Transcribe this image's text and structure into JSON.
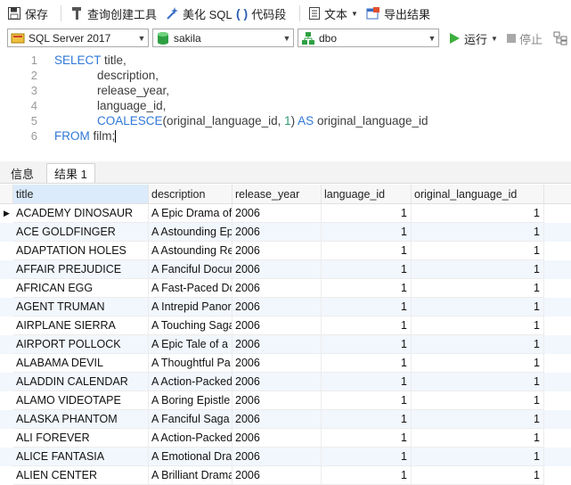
{
  "toolbar": {
    "save": "保存",
    "query_builder": "查询创建工具",
    "beautify": "美化 SQL",
    "snippet": "代码段",
    "text": "文本",
    "export": "导出结果"
  },
  "selectors": {
    "server": "SQL Server 2017",
    "database": "sakila",
    "schema": "dbo",
    "run": "运行",
    "stop": "停止"
  },
  "editor": {
    "line_numbers": [
      "1",
      "2",
      "3",
      "4",
      "5",
      "6"
    ]
  },
  "tabs": {
    "info": "信息",
    "result": "结果 1"
  },
  "table": {
    "columns": [
      "title",
      "description",
      "release_year",
      "language_id",
      "original_language_id"
    ],
    "rows": [
      [
        "ACADEMY DINOSAUR",
        "A Epic Drama of",
        "2006",
        "1",
        "1"
      ],
      [
        "ACE GOLDFINGER",
        "A Astounding Ep",
        "2006",
        "1",
        "1"
      ],
      [
        "ADAPTATION HOLES",
        "A Astounding Re",
        "2006",
        "1",
        "1"
      ],
      [
        "AFFAIR PREJUDICE",
        "A Fanciful Docur",
        "2006",
        "1",
        "1"
      ],
      [
        "AFRICAN EGG",
        "A Fast-Paced Dc",
        "2006",
        "1",
        "1"
      ],
      [
        "AGENT TRUMAN",
        "A Intrepid Panor",
        "2006",
        "1",
        "1"
      ],
      [
        "AIRPLANE SIERRA",
        "A Touching Saga",
        "2006",
        "1",
        "1"
      ],
      [
        "AIRPORT POLLOCK",
        "A Epic Tale of a",
        "2006",
        "1",
        "1"
      ],
      [
        "ALABAMA DEVIL",
        "A Thoughtful Pa",
        "2006",
        "1",
        "1"
      ],
      [
        "ALADDIN CALENDAR",
        "A Action-Packed",
        "2006",
        "1",
        "1"
      ],
      [
        "ALAMO VIDEOTAPE",
        "A Boring Epistle",
        "2006",
        "1",
        "1"
      ],
      [
        "ALASKA PHANTOM",
        "A Fanciful Saga",
        "2006",
        "1",
        "1"
      ],
      [
        "ALI FOREVER",
        "A Action-Packed",
        "2006",
        "1",
        "1"
      ],
      [
        "ALICE FANTASIA",
        "A Emotional Dra",
        "2006",
        "1",
        "1"
      ],
      [
        "ALIEN CENTER",
        "A Brilliant Drama",
        "2006",
        "1",
        "1"
      ]
    ]
  },
  "code": {
    "l1_kw": "SELECT",
    "l1_rest": " title,",
    "l2": "description,",
    "l3": "release_year,",
    "l4": "language_id,",
    "l5_fn": "COALESCE",
    "l5_a": "(original_language_id, ",
    "l5_num": "1",
    "l5_b": ") ",
    "l5_as": "AS",
    "l5_c": " original_language_id",
    "l6_kw": "FROM",
    "l6_rest": " film;"
  },
  "colors": {
    "keyword": "#2f78d6",
    "number": "#2f9a6d",
    "run_icon": "#3cae3c",
    "row_alt": "#f2f7fd"
  }
}
